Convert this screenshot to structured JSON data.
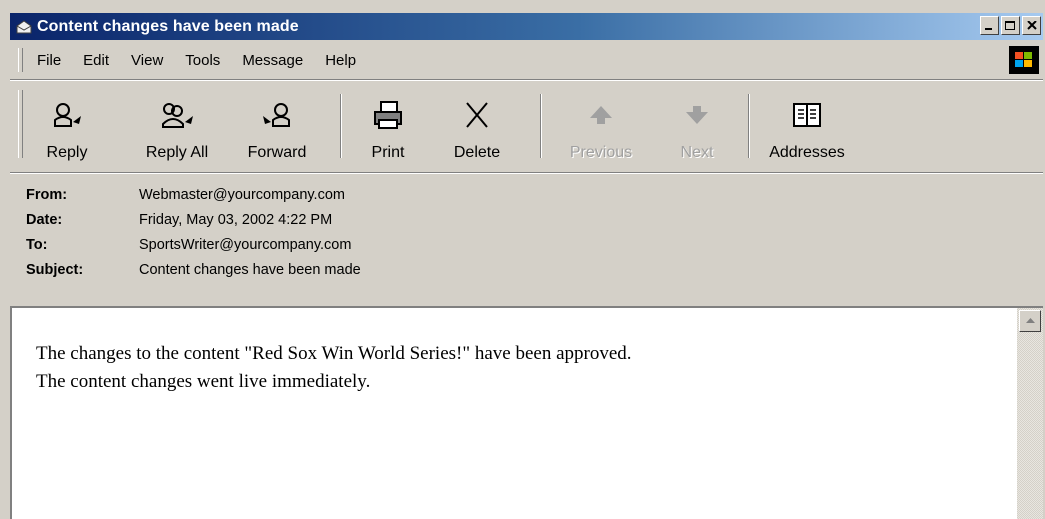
{
  "window": {
    "title": "Content changes have been made"
  },
  "menu": [
    "File",
    "Edit",
    "View",
    "Tools",
    "Message",
    "Help"
  ],
  "toolbar": {
    "reply": "Reply",
    "reply_all": "Reply All",
    "forward": "Forward",
    "print": "Print",
    "delete": "Delete",
    "previous": "Previous",
    "next": "Next",
    "addresses": "Addresses"
  },
  "headers": {
    "from_label": "From:",
    "from_value": "Webmaster@yourcompany.com",
    "date_label": "Date:",
    "date_value": "Friday, May 03, 2002 4:22 PM",
    "to_label": "To:",
    "to_value": "SportsWriter@yourcompany.com",
    "subject_label": "Subject:",
    "subject_value": "Content changes have been made"
  },
  "message": {
    "line1": "The changes to the content \"Red Sox Win World Series!\" have been approved.",
    "line2": "The content changes went live immediately."
  },
  "colors": {
    "titlebar_start": "#0a246a",
    "titlebar_end": "#a6caf0",
    "chrome": "#d4d0c8"
  }
}
